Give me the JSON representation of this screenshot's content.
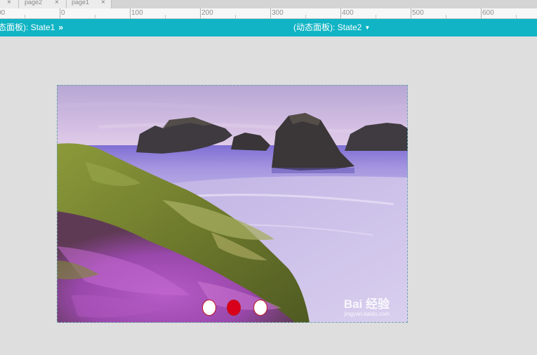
{
  "tabs": [
    {
      "label": "page2"
    },
    {
      "label": "page1"
    }
  ],
  "tab_close_glyph": "×",
  "ruler": {
    "labels": [
      "00",
      "0",
      "100",
      "200",
      "300",
      "400",
      "500",
      "600"
    ]
  },
  "state_bar": {
    "left_label": "态面板): State1",
    "left_arrow": "»",
    "right_label": "(动态面板): State2",
    "right_caret": "▼"
  },
  "slideshow": {
    "watermark_logo": "Bai 经验",
    "watermark_url": "jingyan.baidu.com",
    "dots": [
      {
        "active": false
      },
      {
        "active": true
      },
      {
        "active": false
      }
    ]
  },
  "colors": {
    "state_bar": "#10b4c4",
    "dot_active": "#d9001b",
    "canvas": "#dedede"
  },
  "icons": {
    "tab_close": "close-icon",
    "state_next": "double-chevron-right-icon",
    "state_dropdown": "caret-down-icon"
  }
}
